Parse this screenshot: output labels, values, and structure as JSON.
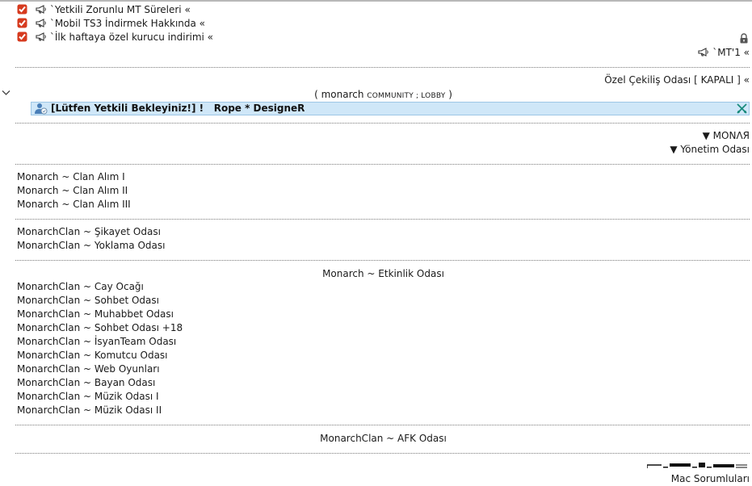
{
  "announcements": [
    {
      "text": "`Yetkili Zorunlu MT Süreleri «"
    },
    {
      "text": "`Mobil TS3 İndirmek Hakkında «"
    },
    {
      "text": "`İlk haftaya özel kurucu indirimi «"
    }
  ],
  "mt_channel": "`MT'1 «",
  "ozel_cekilis": "Özel Çekiliş Odası [ KAPALI ] «",
  "lobby": {
    "prefix": "( monarch ",
    "small": "COMMUNITY ; LOBBY",
    "suffix": " )"
  },
  "highlight_user": {
    "tag": "[Lütfen Yetkili Bekleyiniz!] !",
    "name": "Rope * DesigneR"
  },
  "group_monark": "▼ MONΛЯ",
  "group_yonetim": "▼ Yönetim Odası",
  "clan_alim": [
    "Monarch ~ Clan Alım I",
    "Monarch ~ Clan Alım II",
    "Monarch ~ Clan Alım III"
  ],
  "support": [
    "MonarchClan ~ Şikayet Odası",
    "MonarchClan ~ Yoklama Odası"
  ],
  "etkinlik": "Monarch ~ Etkinlik Odası",
  "rooms": [
    "MonarchClan ~ Cay Ocağı",
    "MonarchClan ~ Sohbet Odası",
    "MonarchClan ~ Muhabbet Odası",
    "MonarchClan ~ Sohbet Odası +18",
    "MonarchClan ~ İsyanTeam Odası",
    "MonarchClan ~ Komutcu Odası",
    "MonarchClan ~ Web Oyunları",
    "MonarchClan ~ Bayan Odası",
    "MonarchClan ~ Müzik Odası I",
    "MonarchClan ~ Müzik Odası II"
  ],
  "afk": "MonarchClan ~ AFK Odası",
  "mac_sorumlulari": "Mac Sorumluları",
  "colors": {
    "highlight_bg": "#cfe7f8",
    "highlight_border": "#9dc7e6",
    "check_red": "#d63a1e"
  }
}
